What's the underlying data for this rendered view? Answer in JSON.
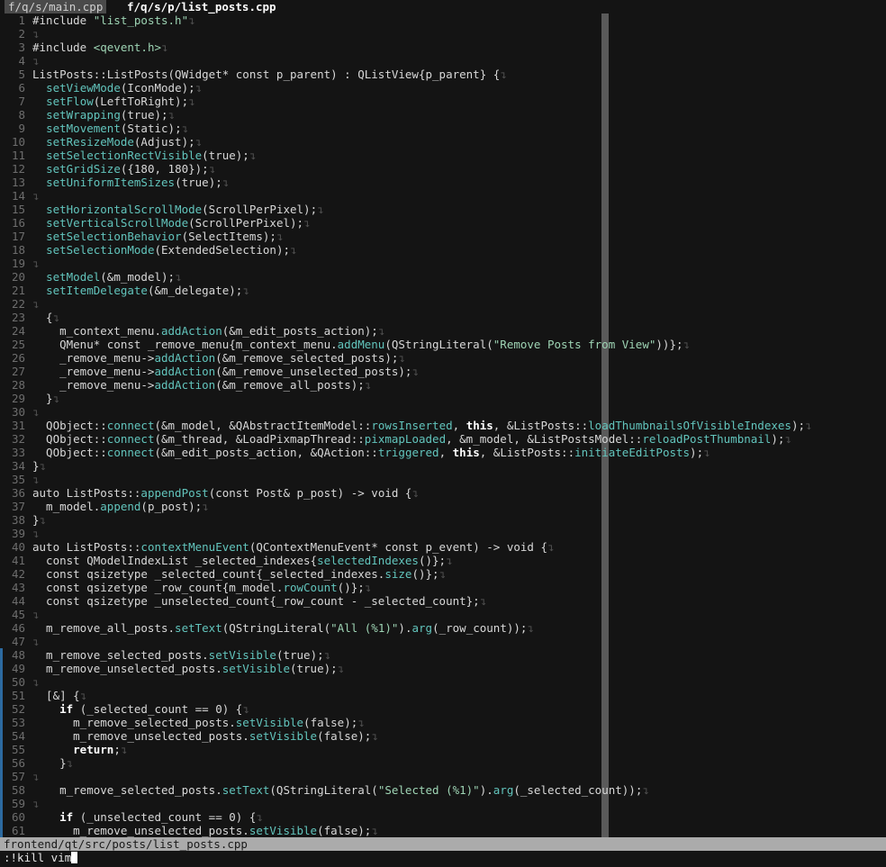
{
  "tabs": [
    {
      "label": "f/q/s/main.cpp",
      "active": false
    },
    {
      "label": "f/q/s/p/list_posts.cpp",
      "active": true
    }
  ],
  "eol_symbol": "↴",
  "colors": {
    "background": "#141414",
    "string": "#9ed4b4",
    "function": "#62c4bc",
    "keyword": "#ffffff",
    "statusline": "#ababab"
  },
  "lines": [
    {
      "n": "1",
      "t": [
        [
          "",
          "#include "
        ],
        [
          "s",
          "\"list_posts.h\""
        ]
      ]
    },
    {
      "n": "2",
      "t": []
    },
    {
      "n": "3",
      "t": [
        [
          "",
          "#include "
        ],
        [
          "s",
          "<qevent.h>"
        ]
      ]
    },
    {
      "n": "4",
      "t": []
    },
    {
      "n": "5",
      "t": [
        [
          "",
          "ListPosts::ListPosts(QWidget* const p_parent) : QListView{p_parent} {"
        ]
      ]
    },
    {
      "n": "6",
      "t": [
        [
          "",
          "  "
        ],
        [
          "f",
          "setViewMode"
        ],
        [
          "",
          "(IconMode);"
        ]
      ]
    },
    {
      "n": "7",
      "t": [
        [
          "",
          "  "
        ],
        [
          "f",
          "setFlow"
        ],
        [
          "",
          "(LeftToRight);"
        ]
      ]
    },
    {
      "n": "8",
      "t": [
        [
          "",
          "  "
        ],
        [
          "f",
          "setWrapping"
        ],
        [
          "",
          "(true);"
        ]
      ]
    },
    {
      "n": "9",
      "t": [
        [
          "",
          "  "
        ],
        [
          "f",
          "setMovement"
        ],
        [
          "",
          "(Static);"
        ]
      ]
    },
    {
      "n": "10",
      "t": [
        [
          "",
          "  "
        ],
        [
          "f",
          "setResizeMode"
        ],
        [
          "",
          "(Adjust);"
        ]
      ]
    },
    {
      "n": "11",
      "t": [
        [
          "",
          "  "
        ],
        [
          "f",
          "setSelectionRectVisible"
        ],
        [
          "",
          "(true);"
        ]
      ]
    },
    {
      "n": "12",
      "t": [
        [
          "",
          "  "
        ],
        [
          "f",
          "setGridSize"
        ],
        [
          "",
          "({180, 180});"
        ]
      ]
    },
    {
      "n": "13",
      "t": [
        [
          "",
          "  "
        ],
        [
          "f",
          "setUniformItemSizes"
        ],
        [
          "",
          "(true);"
        ]
      ]
    },
    {
      "n": "14",
      "t": []
    },
    {
      "n": "15",
      "t": [
        [
          "",
          "  "
        ],
        [
          "f",
          "setHorizontalScrollMode"
        ],
        [
          "",
          "(ScrollPerPixel);"
        ]
      ]
    },
    {
      "n": "16",
      "t": [
        [
          "",
          "  "
        ],
        [
          "f",
          "setVerticalScrollMode"
        ],
        [
          "",
          "(ScrollPerPixel);"
        ]
      ]
    },
    {
      "n": "17",
      "t": [
        [
          "",
          "  "
        ],
        [
          "f",
          "setSelectionBehavior"
        ],
        [
          "",
          "(SelectItems);"
        ]
      ]
    },
    {
      "n": "18",
      "t": [
        [
          "",
          "  "
        ],
        [
          "f",
          "setSelectionMode"
        ],
        [
          "",
          "(ExtendedSelection);"
        ]
      ]
    },
    {
      "n": "19",
      "t": []
    },
    {
      "n": "20",
      "t": [
        [
          "",
          "  "
        ],
        [
          "f",
          "setModel"
        ],
        [
          "",
          "(&m_model);"
        ]
      ]
    },
    {
      "n": "21",
      "t": [
        [
          "",
          "  "
        ],
        [
          "f",
          "setItemDelegate"
        ],
        [
          "",
          "(&m_delegate);"
        ]
      ]
    },
    {
      "n": "22",
      "t": []
    },
    {
      "n": "23",
      "t": [
        [
          "",
          "  {"
        ]
      ]
    },
    {
      "n": "24",
      "t": [
        [
          "",
          "    m_context_menu."
        ],
        [
          "f",
          "addAction"
        ],
        [
          "",
          "(&m_edit_posts_action);"
        ]
      ]
    },
    {
      "n": "25",
      "t": [
        [
          "",
          "    QMenu* const _remove_menu{m_context_menu."
        ],
        [
          "f",
          "addMenu"
        ],
        [
          "",
          "(QStringLiteral("
        ],
        [
          "s",
          "\"Remove Posts from View\""
        ],
        [
          "",
          "))};"
        ]
      ]
    },
    {
      "n": "26",
      "t": [
        [
          "",
          "    _remove_menu->"
        ],
        [
          "f",
          "addAction"
        ],
        [
          "",
          "(&m_remove_selected_posts);"
        ]
      ]
    },
    {
      "n": "27",
      "t": [
        [
          "",
          "    _remove_menu->"
        ],
        [
          "f",
          "addAction"
        ],
        [
          "",
          "(&m_remove_unselected_posts);"
        ]
      ]
    },
    {
      "n": "28",
      "t": [
        [
          "",
          "    _remove_menu->"
        ],
        [
          "f",
          "addAction"
        ],
        [
          "",
          "(&m_remove_all_posts);"
        ]
      ]
    },
    {
      "n": "29",
      "t": [
        [
          "",
          "  }"
        ]
      ]
    },
    {
      "n": "30",
      "t": []
    },
    {
      "n": "31",
      "t": [
        [
          "",
          "  QObject::"
        ],
        [
          "f",
          "connect"
        ],
        [
          "",
          "(&m_model, &QAbstractItemModel::"
        ],
        [
          "f",
          "rowsInserted"
        ],
        [
          "",
          ", "
        ],
        [
          "k",
          "this"
        ],
        [
          "",
          ", &ListPosts::"
        ],
        [
          "f",
          "loadThumbnailsOfVisibleIndexes"
        ],
        [
          "",
          ");"
        ]
      ]
    },
    {
      "n": "32",
      "t": [
        [
          "",
          "  QObject::"
        ],
        [
          "f",
          "connect"
        ],
        [
          "",
          "(&m_thread, &LoadPixmapThread::"
        ],
        [
          "f",
          "pixmapLoaded"
        ],
        [
          "",
          ", &m_model, &ListPostsModel::"
        ],
        [
          "f",
          "reloadPostThumbnail"
        ],
        [
          "",
          ");"
        ]
      ]
    },
    {
      "n": "33",
      "t": [
        [
          "",
          "  QObject::"
        ],
        [
          "f",
          "connect"
        ],
        [
          "",
          "(&m_edit_posts_action, &QAction::"
        ],
        [
          "f",
          "triggered"
        ],
        [
          "",
          ", "
        ],
        [
          "k",
          "this"
        ],
        [
          "",
          ", &ListPosts::"
        ],
        [
          "f",
          "initiateEditPosts"
        ],
        [
          "",
          ");"
        ]
      ]
    },
    {
      "n": "34",
      "t": [
        [
          "",
          "}"
        ]
      ]
    },
    {
      "n": "35",
      "t": []
    },
    {
      "n": "36",
      "t": [
        [
          "",
          "auto ListPosts::"
        ],
        [
          "f",
          "appendPost"
        ],
        [
          "",
          "(const Post& p_post) -> void {"
        ]
      ]
    },
    {
      "n": "37",
      "t": [
        [
          "",
          "  m_model."
        ],
        [
          "f",
          "append"
        ],
        [
          "",
          "(p_post);"
        ]
      ]
    },
    {
      "n": "38",
      "t": [
        [
          "",
          "}"
        ]
      ]
    },
    {
      "n": "39",
      "t": []
    },
    {
      "n": "40",
      "t": [
        [
          "",
          "auto ListPosts::"
        ],
        [
          "f",
          "contextMenuEvent"
        ],
        [
          "",
          "(QContextMenuEvent* const p_event) -> void {"
        ]
      ]
    },
    {
      "n": "41",
      "t": [
        [
          "",
          "  const QModelIndexList _selected_indexes{"
        ],
        [
          "f",
          "selectedIndexes"
        ],
        [
          "",
          "()};"
        ]
      ]
    },
    {
      "n": "42",
      "t": [
        [
          "",
          "  const qsizetype _selected_count{_selected_indexes."
        ],
        [
          "f",
          "size"
        ],
        [
          "",
          "()};"
        ]
      ]
    },
    {
      "n": "43",
      "t": [
        [
          "",
          "  const qsizetype _row_count{m_model."
        ],
        [
          "f",
          "rowCount"
        ],
        [
          "",
          "()};"
        ]
      ]
    },
    {
      "n": "44",
      "t": [
        [
          "",
          "  const qsizetype _unselected_count{_row_count - _selected_count};"
        ]
      ]
    },
    {
      "n": "45",
      "t": []
    },
    {
      "n": "46",
      "t": [
        [
          "",
          "  m_remove_all_posts."
        ],
        [
          "f",
          "setText"
        ],
        [
          "",
          "(QStringLiteral("
        ],
        [
          "s",
          "\"All (%1)\""
        ],
        [
          "",
          ")."
        ],
        [
          "f",
          "arg"
        ],
        [
          "",
          "(_row_count));"
        ]
      ]
    },
    {
      "n": "47",
      "t": []
    },
    {
      "n": "48",
      "t": [
        [
          "",
          "  m_remove_selected_posts."
        ],
        [
          "f",
          "setVisible"
        ],
        [
          "",
          "(true);"
        ]
      ]
    },
    {
      "n": "49",
      "t": [
        [
          "",
          "  m_remove_unselected_posts."
        ],
        [
          "f",
          "setVisible"
        ],
        [
          "",
          "(true);"
        ]
      ]
    },
    {
      "n": "50",
      "t": []
    },
    {
      "n": "51",
      "t": [
        [
          "",
          "  [&] {"
        ]
      ]
    },
    {
      "n": "52",
      "t": [
        [
          "",
          "    "
        ],
        [
          "k",
          "if"
        ],
        [
          "",
          " (_selected_count == 0) {"
        ]
      ]
    },
    {
      "n": "53",
      "t": [
        [
          "",
          "      m_remove_selected_posts."
        ],
        [
          "f",
          "setVisible"
        ],
        [
          "",
          "(false);"
        ]
      ]
    },
    {
      "n": "54",
      "t": [
        [
          "",
          "      m_remove_unselected_posts."
        ],
        [
          "f",
          "setVisible"
        ],
        [
          "",
          "(false);"
        ]
      ]
    },
    {
      "n": "55",
      "t": [
        [
          "",
          "      "
        ],
        [
          "k",
          "return"
        ],
        [
          "",
          ";"
        ]
      ]
    },
    {
      "n": "56",
      "t": [
        [
          "",
          "    }"
        ]
      ]
    },
    {
      "n": "57",
      "t": []
    },
    {
      "n": "58",
      "t": [
        [
          "",
          "    m_remove_selected_posts."
        ],
        [
          "f",
          "setText"
        ],
        [
          "",
          "(QStringLiteral("
        ],
        [
          "s",
          "\"Selected (%1)\""
        ],
        [
          "",
          ")."
        ],
        [
          "f",
          "arg"
        ],
        [
          "",
          "(_selected_count));"
        ]
      ]
    },
    {
      "n": "59",
      "t": []
    },
    {
      "n": "60",
      "t": [
        [
          "",
          "    "
        ],
        [
          "k",
          "if"
        ],
        [
          "",
          " (_unselected_count == 0) {"
        ]
      ]
    },
    {
      "n": "61",
      "t": [
        [
          "",
          "      m_remove_unselected_posts."
        ],
        [
          "f",
          "setVisible"
        ],
        [
          "",
          "(false);"
        ]
      ]
    }
  ],
  "statusline": {
    "path": "frontend/qt/src/posts/list_posts.cpp"
  },
  "cmdline": {
    "text": ":!kill vim"
  }
}
